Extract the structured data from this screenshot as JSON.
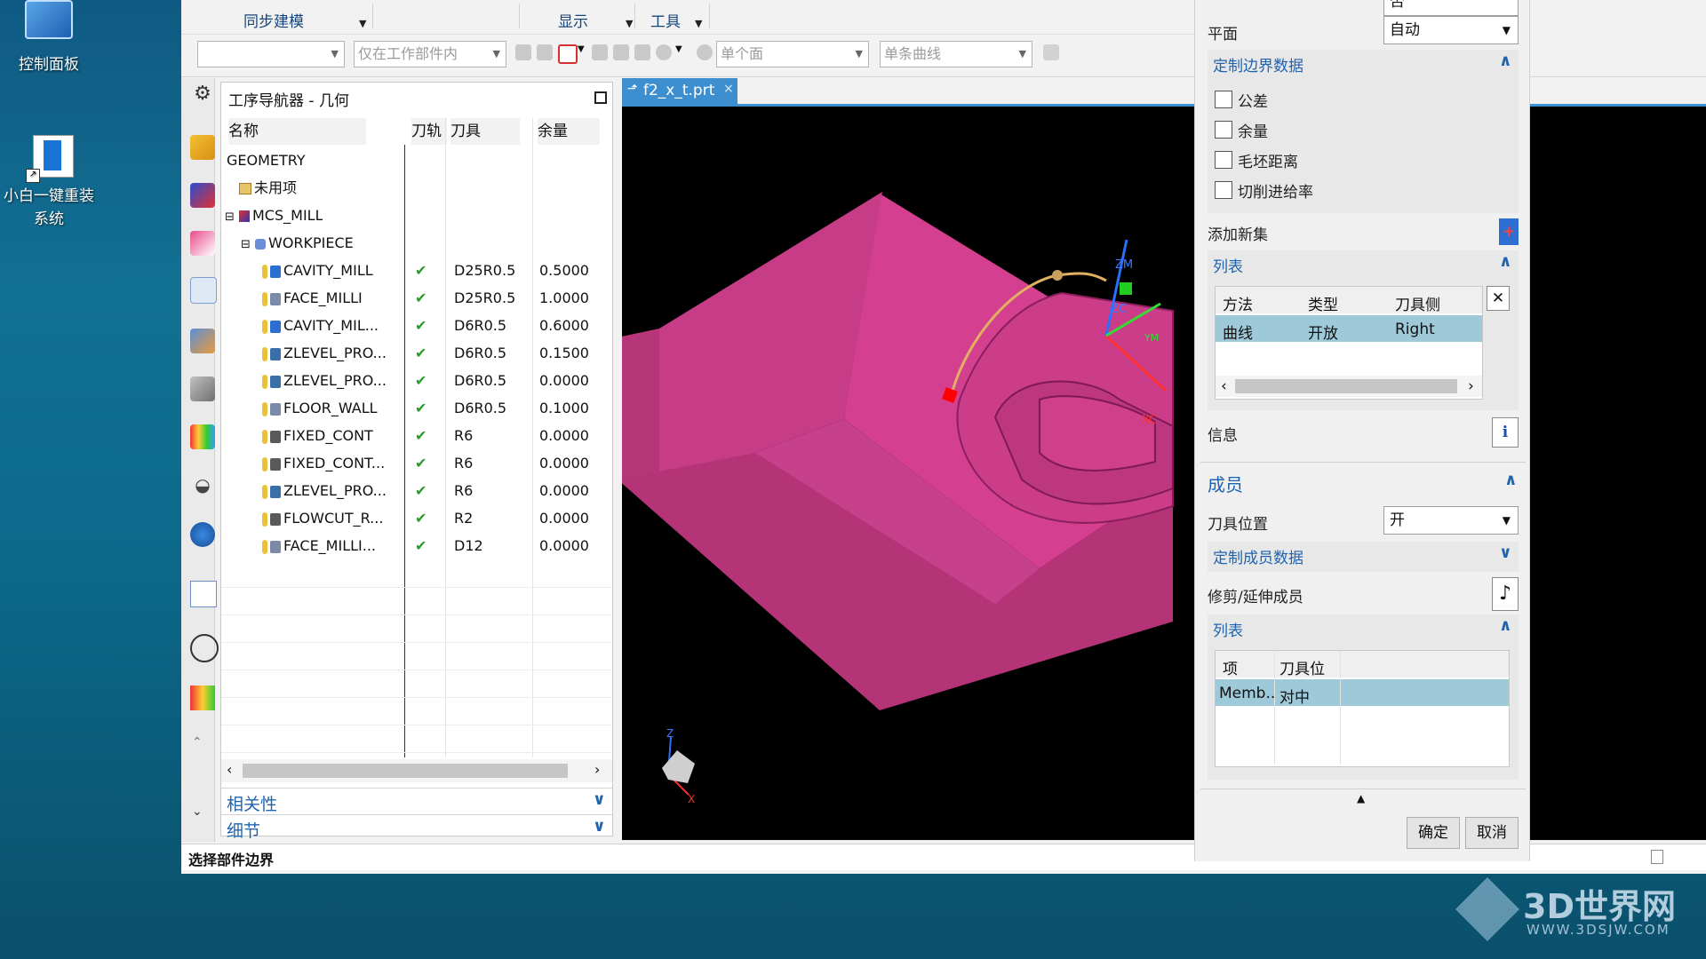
{
  "desktop": {
    "icons": [
      {
        "label": "控制面板"
      },
      {
        "label": "小白一键重装系统"
      }
    ]
  },
  "menubar": {
    "sync_modeling": "同步建模",
    "display": "显示",
    "tools": "工具"
  },
  "toolbar": {
    "filter_empty": "",
    "scope": "仅在工作部件内",
    "face_rule": "单个面",
    "curve_rule": "单条曲线"
  },
  "navigator": {
    "title": "工序导航器 - 几何",
    "columns": [
      "名称",
      "刀轨",
      "刀具",
      "余量"
    ],
    "tree": [
      {
        "name": "GEOMETRY"
      },
      {
        "name": "未用项"
      },
      {
        "name": "MCS_MILL"
      },
      {
        "name": "WORKPIECE"
      }
    ],
    "operations": [
      {
        "name": "CAVITY_MILL",
        "path": "✔",
        "tool": "D25R0.5",
        "stock": "0.5000",
        "icon": "cavity-mill-icon"
      },
      {
        "name": "FACE_MILLI",
        "path": "✔",
        "tool": "D25R0.5",
        "stock": "1.0000",
        "icon": "face-mill-icon"
      },
      {
        "name": "CAVITY_MIL...",
        "path": "✔",
        "tool": "D6R0.5",
        "stock": "0.6000",
        "icon": "cavity-mill-icon"
      },
      {
        "name": "ZLEVEL_PRO...",
        "path": "✔",
        "tool": "D6R0.5",
        "stock": "0.1500",
        "icon": "zlevel-icon"
      },
      {
        "name": "ZLEVEL_PRO...",
        "path": "✔",
        "tool": "D6R0.5",
        "stock": "0.0000",
        "icon": "zlevel-icon"
      },
      {
        "name": "FLOOR_WALL",
        "path": "✔",
        "tool": "D6R0.5",
        "stock": "0.1000",
        "icon": "face-mill-icon"
      },
      {
        "name": "FIXED_CONT",
        "path": "✔",
        "tool": "R6",
        "stock": "0.0000",
        "icon": "fixed-contour-icon"
      },
      {
        "name": "FIXED_CONT...",
        "path": "✔",
        "tool": "R6",
        "stock": "0.0000",
        "icon": "fixed-contour-icon"
      },
      {
        "name": "ZLEVEL_PRO...",
        "path": "✔",
        "tool": "R6",
        "stock": "0.0000",
        "icon": "zlevel-icon"
      },
      {
        "name": "FLOWCUT_R...",
        "path": "✔",
        "tool": "R2",
        "stock": "0.0000",
        "icon": "fixed-contour-icon"
      },
      {
        "name": "FACE_MILLI...",
        "path": "✔",
        "tool": "D12",
        "stock": "0.0000",
        "icon": "face-mill-icon"
      }
    ],
    "panels": [
      "相关性",
      "细节"
    ]
  },
  "graphics": {
    "tab_label": "f2_x_t.prt"
  },
  "dialog": {
    "top_value": "否",
    "plane_label": "平面",
    "plane_value": "自动",
    "custom_boundary_header": "定制边界数据",
    "checkboxes": [
      "公差",
      "余量",
      "毛坯距离",
      "切削进给率"
    ],
    "add_new_set": "添加新集",
    "list_header": "列表",
    "list_columns": [
      "方法",
      "类型",
      "刀具侧"
    ],
    "list_row": [
      "曲线",
      "开放",
      "Right"
    ],
    "info_label": "信息",
    "members_header": "成员",
    "tool_position_label": "刀具位置",
    "tool_position_value": "开",
    "custom_member_header": "定制成员数据",
    "trim_extend_label": "修剪/延伸成员",
    "list2_header": "列表",
    "list2_columns": [
      "项",
      "刀具位"
    ],
    "list2_row": [
      "Memb...",
      "对中"
    ],
    "ok": "确定",
    "cancel": "取消"
  },
  "statusbar": {
    "message": "选择部件边界"
  },
  "watermark": {
    "brand": "3D世界网",
    "url": "WWW.3DSJW.COM"
  }
}
